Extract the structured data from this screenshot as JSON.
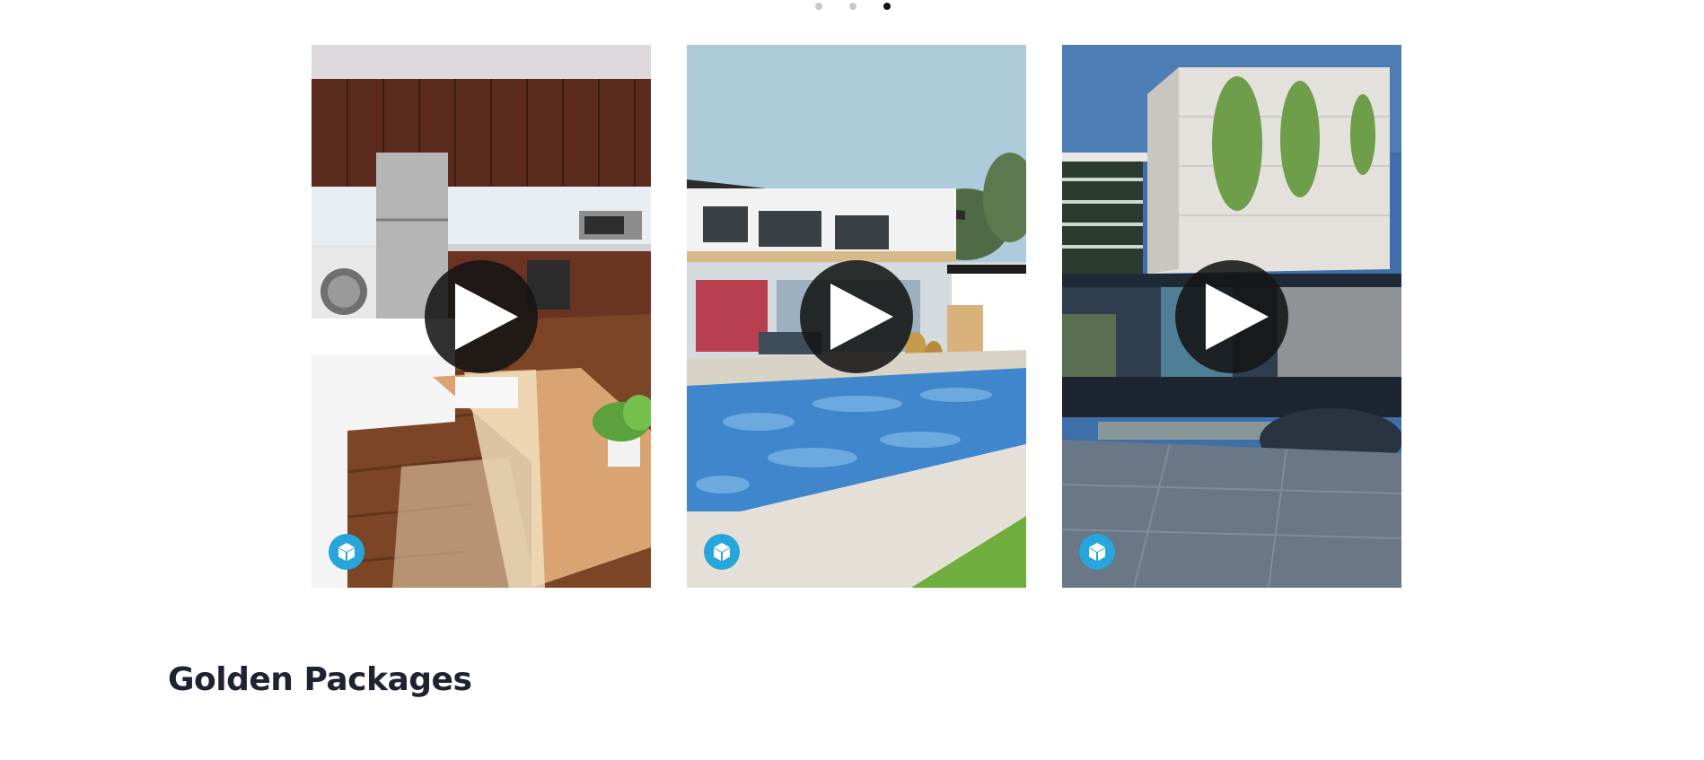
{
  "carousel": {
    "indicators": [
      {
        "active": false
      },
      {
        "active": false
      },
      {
        "active": true
      }
    ],
    "cards": [
      {
        "scene": "kitchen-living-room",
        "play_icon": "play-icon",
        "badge_icon": "cube-3d-icon"
      },
      {
        "scene": "villa-pool",
        "play_icon": "play-icon",
        "badge_icon": "cube-3d-icon"
      },
      {
        "scene": "modern-house-facade",
        "play_icon": "play-icon",
        "badge_icon": "cube-3d-icon"
      }
    ],
    "badge_color": "#27a6db",
    "play_button_color": "#141414"
  },
  "section": {
    "title": "Golden Packages"
  }
}
